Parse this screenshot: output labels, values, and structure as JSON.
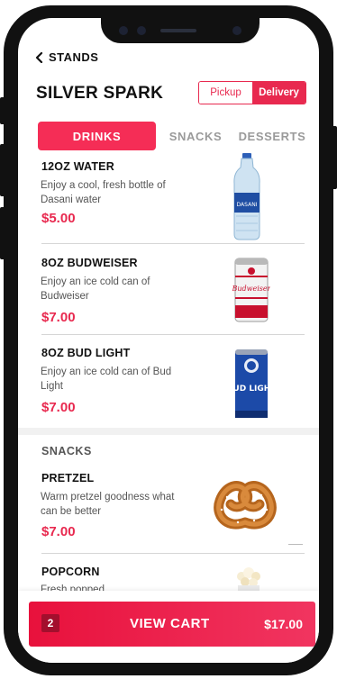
{
  "header": {
    "back_label": "STANDS",
    "stand_name": "SILVER SPARK",
    "order_modes": [
      "Pickup",
      "Delivery"
    ],
    "selected_mode": "Delivery"
  },
  "tabs": [
    {
      "label": "DRINKS",
      "active": true
    },
    {
      "label": "SNACKS",
      "active": false
    },
    {
      "label": "DESSERTS",
      "active": false
    }
  ],
  "drinks": [
    {
      "name": "12OZ WATER",
      "description": "Enjoy a cool, fresh bottle of Dasani water",
      "price": "$5.00",
      "image": "water-bottle-icon",
      "brand_text": "DASANI"
    },
    {
      "name": "8OZ BUDWEISER",
      "description": "Enjoy an ice cold can of Budweiser",
      "price": "$7.00",
      "image": "budweiser-can-icon",
      "brand_text": "Budweiser"
    },
    {
      "name": "8OZ BUD LIGHT",
      "description": "Enjoy an ice cold can of Bud Light",
      "price": "$7.00",
      "image": "bud-light-can-icon",
      "brand_text": "BUD LIGHT"
    }
  ],
  "snacks_section": {
    "label": "SNACKS",
    "items": [
      {
        "name": "PRETZEL",
        "description": "Warm pretzel goodness what can be better",
        "price": "$7.00",
        "image": "pretzel-icon"
      },
      {
        "name": "POPCORN",
        "description": "Fresh popped",
        "image": "popcorn-icon"
      }
    ]
  },
  "cart": {
    "count": "2",
    "label": "VIEW CART",
    "total": "$17.00"
  },
  "colors": {
    "accent": "#e8294f",
    "tab_active": "#f52d56",
    "inactive_tab": "#9a9a9a"
  }
}
